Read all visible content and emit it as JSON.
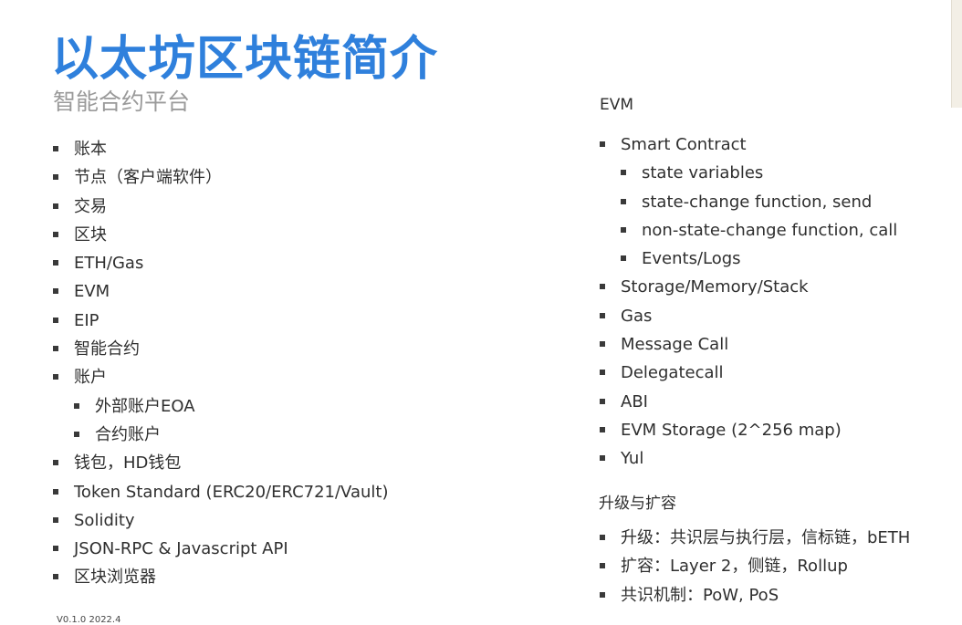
{
  "title": "以太坊区块链简介",
  "subtitle": "智能合约平台",
  "left_items": [
    {
      "label": "账本",
      "level": 1
    },
    {
      "label": "节点（客户端软件）",
      "level": 1
    },
    {
      "label": "交易",
      "level": 1
    },
    {
      "label": "区块",
      "level": 1
    },
    {
      "label": "ETH/Gas",
      "level": 1
    },
    {
      "label": "EVM",
      "level": 1
    },
    {
      "label": "EIP",
      "level": 1
    },
    {
      "label": "智能合约",
      "level": 1
    },
    {
      "label": "账户",
      "level": 1
    },
    {
      "label": "外部账户EOA",
      "level": 2
    },
    {
      "label": "合约账户",
      "level": 2
    },
    {
      "label": "钱包，HD钱包",
      "level": 1
    },
    {
      "label": "Token Standard (ERC20/ERC721/Vault)",
      "level": 1
    },
    {
      "label": "Solidity",
      "level": 1
    },
    {
      "label": "JSON-RPC & Javascript API",
      "level": 1
    },
    {
      "label": "区块浏览器",
      "level": 1
    }
  ],
  "evm_heading": "EVM",
  "evm_items": [
    {
      "label": "Smart Contract",
      "level": 1
    },
    {
      "label": "state variables",
      "level": 2
    },
    {
      "label": "state-change function, send",
      "level": 2
    },
    {
      "label": "non-state-change function, call",
      "level": 2
    },
    {
      "label": "Events/Logs",
      "level": 2
    },
    {
      "label": "Storage/Memory/Stack",
      "level": 1
    },
    {
      "label": "Gas",
      "level": 1
    },
    {
      "label": "Message Call",
      "level": 1
    },
    {
      "label": "Delegatecall",
      "level": 1
    },
    {
      "label": "ABI",
      "level": 1
    },
    {
      "label": "EVM Storage (2^256 map)",
      "level": 1
    },
    {
      "label": "Yul",
      "level": 1
    }
  ],
  "upgrade_heading": "升级与扩容",
  "upgrade_items": [
    {
      "label": "升级：共识层与执行层，信标链，bETH",
      "level": 1
    },
    {
      "label": "扩容：Layer 2，侧链，Rollup",
      "level": 1
    },
    {
      "label": "共识机制：PoW, PoS",
      "level": 1
    }
  ],
  "version": "V0.1.0 2022.4",
  "colors": {
    "title": "#2f80dc",
    "subtitle": "#9a9a9a",
    "text": "#2f2f2f"
  }
}
